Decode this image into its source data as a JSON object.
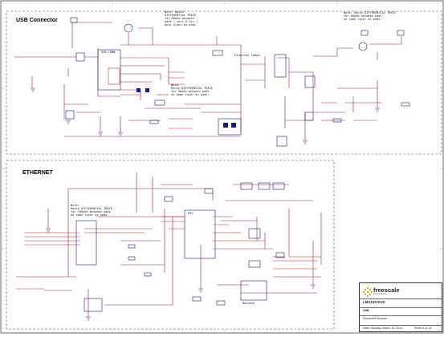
{
  "sections": {
    "usb": {
      "title": "USB Connector"
    },
    "ethernet": {
      "title": "ETHERNET"
    }
  },
  "notes": {
    "top_center": "Note: Route\nDIFFERENTIAL TRACE\nfor 90ohm between\npads ( sort 0.1in )\nmust plane on pads.",
    "top_right": "Note: Route DIFFERENTIAL TRACE\nfor 90ohm between pads\non same layer as pads.",
    "mid_center": "Note:\nRoute DIFFERENTIAL TRACE\nfor 90ohm between pads\non same layer as pads.",
    "ethernet": "Note:\nRoute DIFFERENTIAL TRACE\nfor 100ohm between pads\non same layer as pads."
  },
  "labels": {
    "ethernet_lamps": "Ethernet Lamps",
    "usb_conn": "USB_CONN",
    "phy": "PHY",
    "magnetics": "MAGJACK"
  },
  "title_block": {
    "company": "freescale",
    "company_sub": "semiconductor",
    "board": "i.MX233 EVK",
    "sheet_title": "USB",
    "doc_label": "Document Number",
    "date_label": "Date: Monday, March 15, 2010",
    "sheet_label": "Sheet 4 of 14"
  },
  "colors": {
    "wire": "#9a1a5a",
    "net_red": "#d42020",
    "part": "#1a1a7a",
    "frame": "#333333",
    "logo": "#e8a21c"
  }
}
